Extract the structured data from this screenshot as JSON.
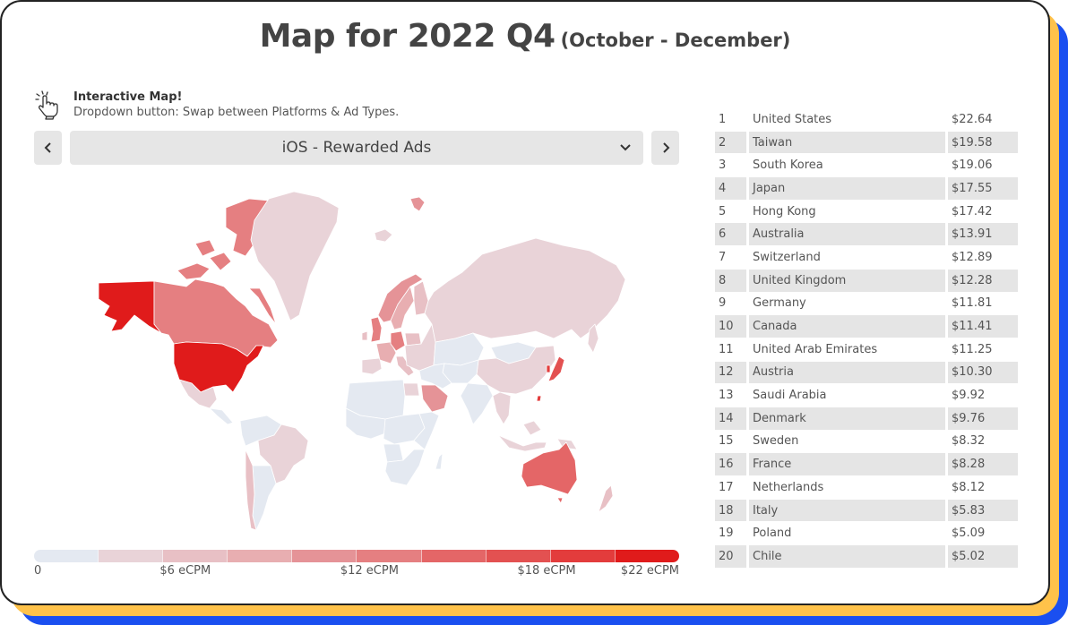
{
  "header": {
    "title": "Map for 2022 Q4",
    "subtitle": "(October - December)"
  },
  "hint": {
    "icon": "hand-pointer-click-icon",
    "heading": "Interactive Map!",
    "text": "Dropdown button: Swap between Platforms & Ad Types."
  },
  "selector": {
    "prev_icon": "chevron-left-icon",
    "next_icon": "chevron-right-icon",
    "dropdown_icon": "chevron-down-icon",
    "selected": "iOS - Rewarded Ads"
  },
  "legend": {
    "colors": [
      "#e4e9f1",
      "#e9d3d8",
      "#e8c0c5",
      "#e8aeb1",
      "#e59397",
      "#e57f81",
      "#e46667",
      "#e35151",
      "#e33c3c",
      "#e01b1b"
    ],
    "labels": [
      {
        "text": "0",
        "value": 0
      },
      {
        "text": "$6 eCPM",
        "value": 6
      },
      {
        "text": "$12 eCPM",
        "value": 12
      },
      {
        "text": "$18 eCPM",
        "value": 18
      },
      {
        "text": "$22 eCPM",
        "value": 22
      }
    ],
    "min": 0,
    "max": 22
  },
  "ranking": [
    {
      "rank": "1",
      "country": "United States",
      "value": "$22.64"
    },
    {
      "rank": "2",
      "country": "Taiwan",
      "value": "$19.58"
    },
    {
      "rank": "3",
      "country": "South Korea",
      "value": "$19.06"
    },
    {
      "rank": "4",
      "country": "Japan",
      "value": "$17.55"
    },
    {
      "rank": "5",
      "country": "Hong Kong",
      "value": "$17.42"
    },
    {
      "rank": "6",
      "country": "Australia",
      "value": "$13.91"
    },
    {
      "rank": "7",
      "country": "Switzerland",
      "value": "$12.89"
    },
    {
      "rank": "8",
      "country": "United Kingdom",
      "value": "$12.28"
    },
    {
      "rank": "9",
      "country": "Germany",
      "value": "$11.81"
    },
    {
      "rank": "10",
      "country": "Canada",
      "value": "$11.41"
    },
    {
      "rank": "11",
      "country": "United Arab Emirates",
      "value": "$11.25"
    },
    {
      "rank": "12",
      "country": "Austria",
      "value": "$10.30"
    },
    {
      "rank": "13",
      "country": "Saudi Arabia",
      "value": "$9.92"
    },
    {
      "rank": "14",
      "country": "Denmark",
      "value": "$9.76"
    },
    {
      "rank": "15",
      "country": "Sweden",
      "value": "$8.32"
    },
    {
      "rank": "16",
      "country": "France",
      "value": "$8.28"
    },
    {
      "rank": "17",
      "country": "Netherlands",
      "value": "$8.12"
    },
    {
      "rank": "18",
      "country": "Italy",
      "value": "$5.83"
    },
    {
      "rank": "19",
      "country": "Poland",
      "value": "$5.09"
    },
    {
      "rank": "20",
      "country": "Chile",
      "value": "$5.02"
    }
  ],
  "map_regions": [
    {
      "name": "United States",
      "value": 22.64
    },
    {
      "name": "Alaska (United States)",
      "value": 22.64
    },
    {
      "name": "Canada",
      "value": 11.41
    },
    {
      "name": "Greenland",
      "value": 3.5
    },
    {
      "name": "Mexico",
      "value": 3.0
    },
    {
      "name": "Central America",
      "value": 0.5
    },
    {
      "name": "Brazil",
      "value": 3.5
    },
    {
      "name": "Argentina",
      "value": 1.0
    },
    {
      "name": "Chile",
      "value": 5.02
    },
    {
      "name": "Northern South America",
      "value": 0.3
    },
    {
      "name": "United Kingdom",
      "value": 12.28
    },
    {
      "name": "Ireland",
      "value": 6.0
    },
    {
      "name": "France",
      "value": 8.28
    },
    {
      "name": "Spain",
      "value": 4.0
    },
    {
      "name": "Germany",
      "value": 11.81
    },
    {
      "name": "Italy",
      "value": 5.83
    },
    {
      "name": "Poland",
      "value": 5.09
    },
    {
      "name": "Norway",
      "value": 9.0
    },
    {
      "name": "Sweden",
      "value": 8.32
    },
    {
      "name": "Finland",
      "value": 5.0
    },
    {
      "name": "Eastern Europe",
      "value": 2.5
    },
    {
      "name": "Iceland",
      "value": 4.0
    },
    {
      "name": "Svalbard",
      "value": 9.0
    },
    {
      "name": "Russia",
      "value": 3.5
    },
    {
      "name": "Kazakhstan",
      "value": 2.0
    },
    {
      "name": "Mongolia",
      "value": 0.5
    },
    {
      "name": "China",
      "value": 3.5
    },
    {
      "name": "Japan",
      "value": 17.55
    },
    {
      "name": "South Korea",
      "value": 19.06
    },
    {
      "name": "Taiwan",
      "value": 19.58
    },
    {
      "name": "India",
      "value": 2.0
    },
    {
      "name": "Central Asia",
      "value": 0.5
    },
    {
      "name": "Saudi Arabia",
      "value": 9.92
    },
    {
      "name": "Middle East",
      "value": 1.0
    },
    {
      "name": "North Africa",
      "value": 0.5
    },
    {
      "name": "Egypt",
      "value": 2.5
    },
    {
      "name": "West Africa",
      "value": 0.3
    },
    {
      "name": "Central Africa",
      "value": 0.3
    },
    {
      "name": "Angola",
      "value": 2.0
    },
    {
      "name": "Southern Africa",
      "value": 0.3
    },
    {
      "name": "East Africa",
      "value": 2.0
    },
    {
      "name": "Madagascar",
      "value": 0.5
    },
    {
      "name": "Southeast Asia",
      "value": 3.0
    },
    {
      "name": "Indonesia",
      "value": 3.0
    },
    {
      "name": "Papua New Guinea",
      "value": 3.0
    },
    {
      "name": "Australia",
      "value": 13.91
    },
    {
      "name": "New Zealand",
      "value": 5.0
    },
    {
      "name": "Sakhalin",
      "value": 3.5
    }
  ]
}
